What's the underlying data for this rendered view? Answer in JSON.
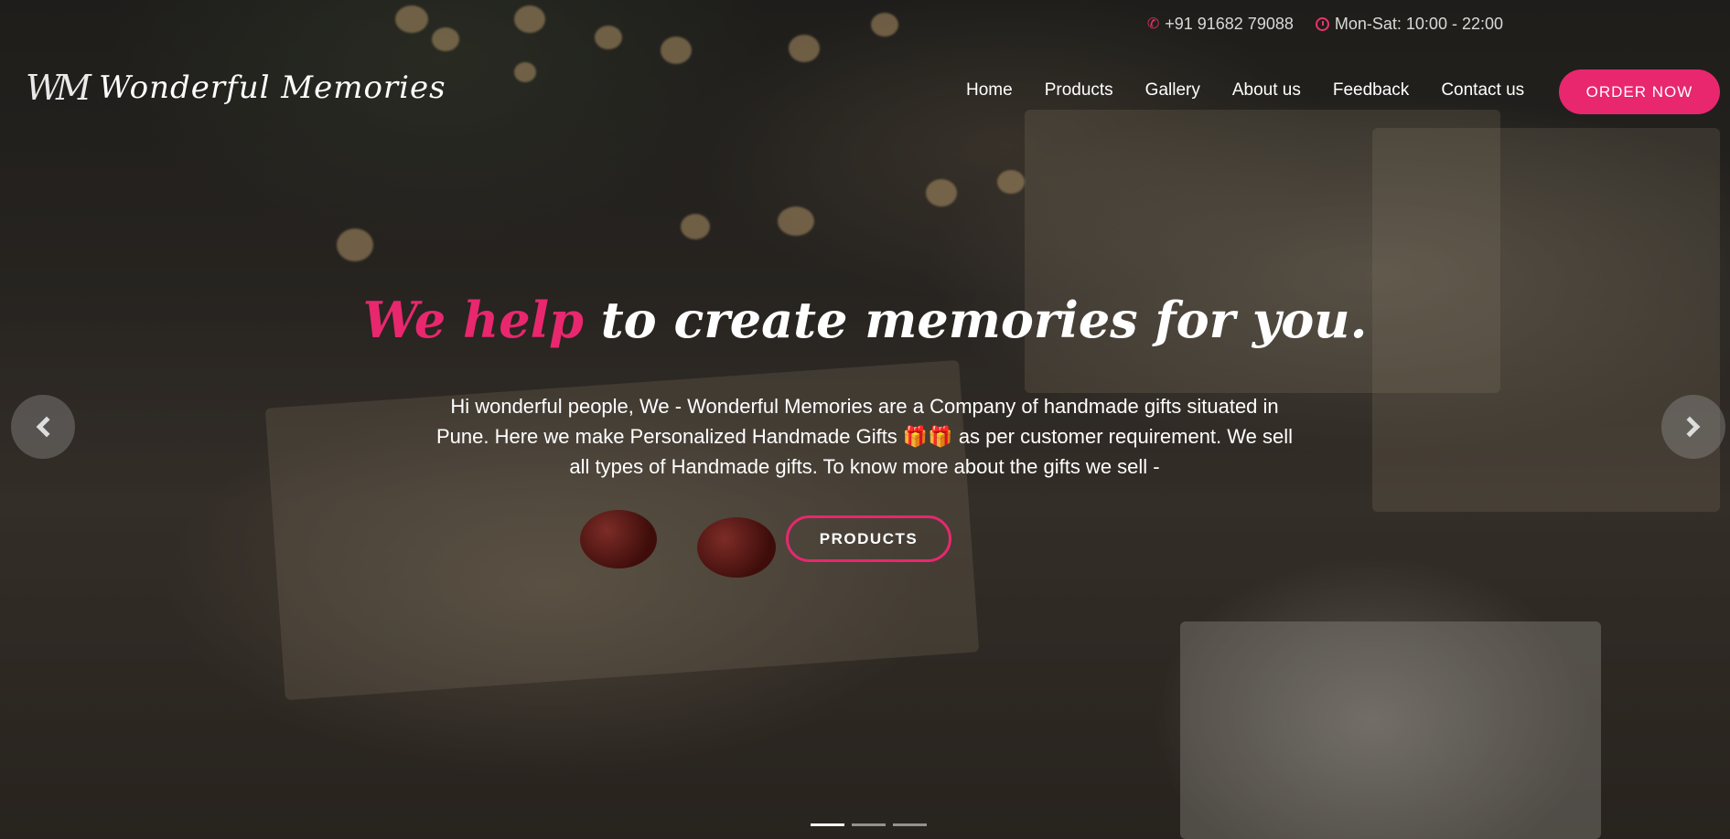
{
  "topbar": {
    "phone": "+91 91682 79088",
    "hours": "Mon-Sat: 10:00 - 22:00",
    "phone_icon": "phone-icon",
    "clock_icon": "clock-icon"
  },
  "header": {
    "logo_mark": "WM",
    "logo_text": "Wonderful Memories",
    "nav": [
      "Home",
      "Products",
      "Gallery",
      "About us",
      "Feedback",
      "Contact us"
    ],
    "order_button": "ORDER NOW"
  },
  "hero": {
    "headline_accent": "We help",
    "headline_rest": " to create memories for you.",
    "description": "Hi wonderful people, We - Wonderful Memories are a Company of handmade gifts situated in Pune. Here we make Personalized Handmade Gifts 🎁🎁 as per customer requirement. We sell all types of Handmade gifts. To know more about the gifts we sell -",
    "cta": "PRODUCTS"
  },
  "carousel": {
    "prev_icon": "chevron-left-icon",
    "next_icon": "chevron-right-icon",
    "active_slide": 1,
    "slide_count": 3
  },
  "colors": {
    "accent": "#e8276e",
    "text": "#ffffff"
  }
}
